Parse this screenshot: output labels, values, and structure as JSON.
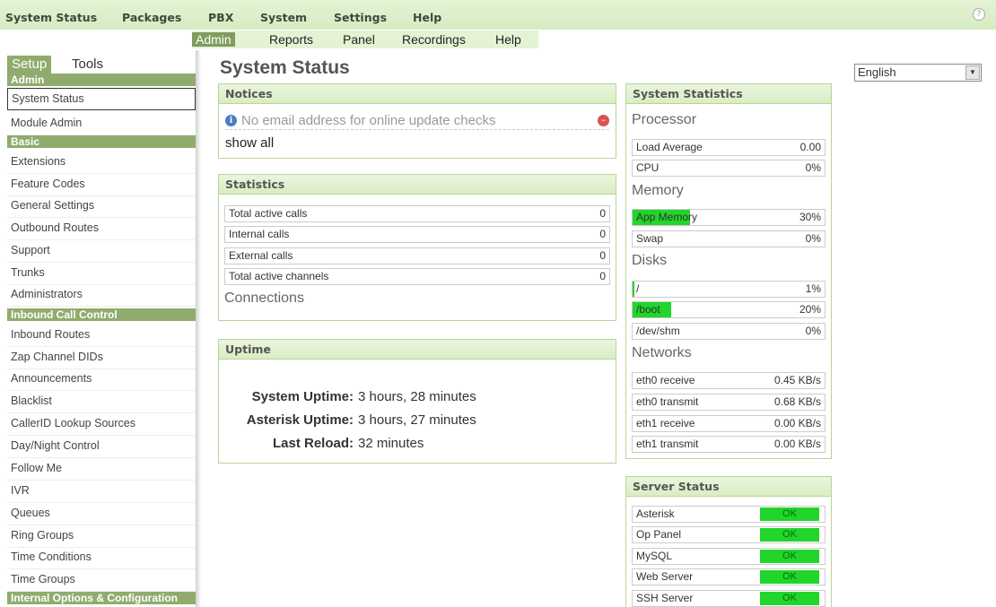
{
  "top_menu": {
    "items": [
      "System Status",
      "Packages",
      "PBX",
      "System",
      "Settings",
      "Help"
    ],
    "help_icon": "?"
  },
  "sub_nav": {
    "items": [
      "Admin",
      "Reports",
      "Panel",
      "Recordings",
      "Help"
    ],
    "active": "Admin"
  },
  "sidebar": {
    "tabs": [
      "Setup",
      "Tools"
    ],
    "active_tab": "Setup",
    "sections": [
      {
        "title": "Admin",
        "items": [
          "System Status",
          "Module Admin"
        ]
      },
      {
        "title": "Basic",
        "items": [
          "Extensions",
          "Feature Codes",
          "General Settings",
          "Outbound Routes",
          "Support",
          "Trunks",
          "Administrators"
        ]
      },
      {
        "title": "Inbound Call Control",
        "items": [
          "Inbound Routes",
          "Zap Channel DIDs",
          "Announcements",
          "Blacklist",
          "CallerID Lookup Sources",
          "Day/Night Control",
          "Follow Me",
          "IVR",
          "Queues",
          "Ring Groups",
          "Time Conditions",
          "Time Groups"
        ]
      },
      {
        "title": "Internal Options & Configuration",
        "items": []
      }
    ],
    "selected_item": "System Status"
  },
  "page_title": "System Status",
  "language": {
    "selected": "English"
  },
  "notices": {
    "title": "Notices",
    "message": "No email address for online update checks",
    "show_all": "show all"
  },
  "statistics": {
    "title": "Statistics",
    "rows": [
      {
        "label": "Total active calls",
        "value": "0"
      },
      {
        "label": "Internal calls",
        "value": "0"
      },
      {
        "label": "External calls",
        "value": "0"
      },
      {
        "label": "Total active channels",
        "value": "0"
      }
    ],
    "connections_label": "Connections"
  },
  "uptime": {
    "title": "Uptime",
    "rows": [
      {
        "label": "System Uptime:",
        "value": "3 hours, 28 minutes"
      },
      {
        "label": "Asterisk Uptime:",
        "value": "3 hours, 27 minutes"
      },
      {
        "label": "Last Reload:",
        "value": "32 minutes"
      }
    ]
  },
  "system_statistics": {
    "title": "System Statistics",
    "processor": {
      "heading": "Processor",
      "rows": [
        {
          "label": "Load Average",
          "value": "0.00"
        },
        {
          "label": "CPU",
          "value": "0%"
        }
      ]
    },
    "memory": {
      "heading": "Memory",
      "rows": [
        {
          "label": "App Memory",
          "value": "30%",
          "fill": 0.3
        },
        {
          "label": "Swap",
          "value": "0%",
          "fill": 0
        }
      ]
    },
    "disks": {
      "heading": "Disks",
      "rows": [
        {
          "label": "/",
          "value": "1%",
          "fill": 0.01
        },
        {
          "label": "/boot",
          "value": "20%",
          "fill": 0.2
        },
        {
          "label": "/dev/shm",
          "value": "0%",
          "fill": 0
        }
      ]
    },
    "networks": {
      "heading": "Networks",
      "rows": [
        {
          "label": "eth0 receive",
          "value": "0.45 KB/s"
        },
        {
          "label": "eth0 transmit",
          "value": "0.68 KB/s"
        },
        {
          "label": "eth1 receive",
          "value": "0.00 KB/s"
        },
        {
          "label": "eth1 transmit",
          "value": "0.00 KB/s"
        }
      ]
    }
  },
  "server_status": {
    "title": "Server Status",
    "rows": [
      {
        "label": "Asterisk",
        "status": "OK"
      },
      {
        "label": "Op Panel",
        "status": "OK"
      },
      {
        "label": "MySQL",
        "status": "OK"
      },
      {
        "label": "Web Server",
        "status": "OK"
      },
      {
        "label": "SSH Server",
        "status": "OK"
      }
    ],
    "ok_color": "#21d52b"
  }
}
